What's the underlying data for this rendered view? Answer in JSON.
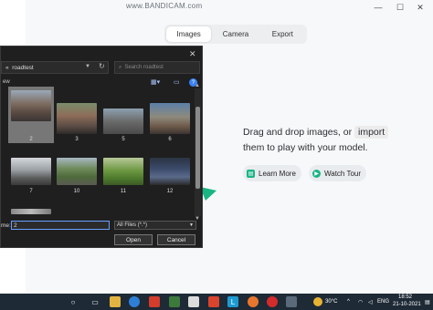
{
  "watermark": "www.BANDICAM.com",
  "window_controls": {
    "minimize": "—",
    "restore": "☐",
    "close": "✕"
  },
  "tabs": [
    {
      "label": "Images",
      "active": true
    },
    {
      "label": "Camera",
      "active": false
    },
    {
      "label": "Export",
      "active": false
    }
  ],
  "drop_zone": {
    "line1": "Drag and drop images, or",
    "import_link": "import",
    "line2": "them to play with your model."
  },
  "buttons": {
    "learn_more": "Learn More",
    "watch_tour": "Watch Tour"
  },
  "dialog": {
    "close": "✕",
    "address_prefix": "«",
    "address": "roadtest",
    "search_placeholder": "Search roadtest",
    "toolbar_left": "ew",
    "help": "?",
    "thumbnails": [
      {
        "label": "2",
        "selected": true
      },
      {
        "label": "3",
        "selected": false
      },
      {
        "label": "5",
        "selected": false
      },
      {
        "label": "6",
        "selected": false
      },
      {
        "label": "7",
        "selected": false
      },
      {
        "label": "10",
        "selected": false
      },
      {
        "label": "11",
        "selected": false
      },
      {
        "label": "12",
        "selected": false
      }
    ],
    "filename_label": "me:",
    "filename_value": "2",
    "filetype_value": "All Files (*.*)",
    "open": "Open",
    "cancel": "Cancel"
  },
  "taskbar": {
    "weather": "30°C",
    "language": "ENG",
    "time": "18:52",
    "date": "21-10-2021"
  },
  "colors": {
    "accent_green": "#19b583",
    "dialog_bg": "#1f1f1f",
    "taskbar_bg": "#1e2a36"
  }
}
